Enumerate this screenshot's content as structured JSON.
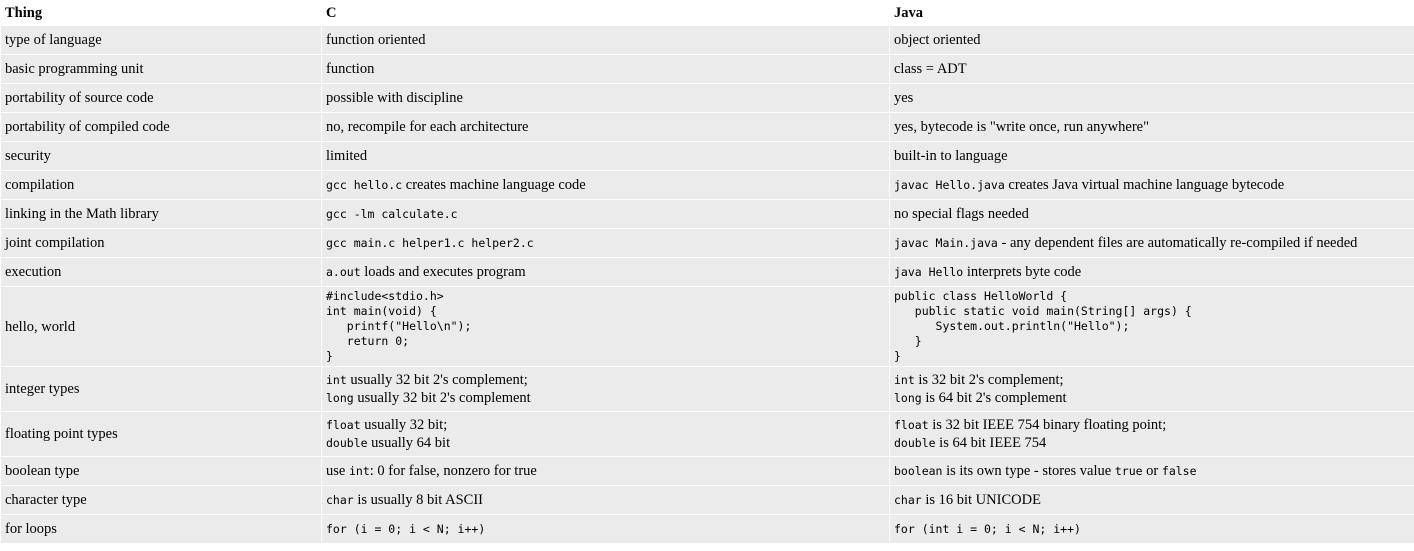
{
  "headers": [
    "Thing",
    "C",
    "Java"
  ],
  "rows": [
    {
      "thing": "type of language",
      "c": [
        {
          "t": "function oriented"
        }
      ],
      "java": [
        {
          "t": "object oriented"
        }
      ]
    },
    {
      "thing": "basic programming unit",
      "c": [
        {
          "t": "function"
        }
      ],
      "java": [
        {
          "t": "class = ADT"
        }
      ]
    },
    {
      "thing": "portability of source code",
      "c": [
        {
          "t": "possible with discipline"
        }
      ],
      "java": [
        {
          "t": "yes"
        }
      ]
    },
    {
      "thing": "portability of compiled code",
      "c": [
        {
          "t": "no, recompile for each architecture"
        }
      ],
      "java": [
        {
          "t": "yes, bytecode is \"write once, run anywhere\""
        }
      ]
    },
    {
      "thing": "security",
      "c": [
        {
          "t": "limited"
        }
      ],
      "java": [
        {
          "t": "built-in to language"
        }
      ]
    },
    {
      "thing": "compilation",
      "c": [
        {
          "code": "gcc hello.c"
        },
        {
          "t": " creates machine language code"
        }
      ],
      "java": [
        {
          "code": "javac Hello.java"
        },
        {
          "t": " creates Java virtual machine language bytecode"
        }
      ]
    },
    {
      "thing": "linking in the Math library",
      "c": [
        {
          "code": "gcc -lm calculate.c"
        }
      ],
      "java": [
        {
          "t": "no special flags needed"
        }
      ]
    },
    {
      "thing": "joint compilation",
      "c": [
        {
          "code": "gcc main.c helper1.c helper2.c"
        }
      ],
      "java": [
        {
          "code": "javac Main.java"
        },
        {
          "t": " - any dependent files are automatically re-compiled if needed"
        }
      ]
    },
    {
      "thing": "execution",
      "c": [
        {
          "code": "a.out"
        },
        {
          "t": " loads and executes program"
        }
      ],
      "java": [
        {
          "code": "java Hello"
        },
        {
          "t": " interprets byte code"
        }
      ]
    },
    {
      "thing": "hello, world",
      "kind": "pre",
      "c": [
        {
          "pre": "#include<stdio.h>\nint main(void) {\n   printf(\"Hello\\n\");\n   return 0;\n}"
        }
      ],
      "java": [
        {
          "pre": "public class HelloWorld {\n   public static void main(String[] args) {\n      System.out.println(\"Hello\");\n   }\n}"
        }
      ]
    },
    {
      "thing": "integer types",
      "kind": "two-line",
      "c": [
        {
          "code": "int"
        },
        {
          "t": " usually 32 bit 2's complement;"
        },
        {
          "br": true
        },
        {
          "code": "long"
        },
        {
          "t": " usually 32 bit 2's complement"
        }
      ],
      "java": [
        {
          "code": "int"
        },
        {
          "t": " is 32 bit 2's complement;"
        },
        {
          "br": true
        },
        {
          "code": "long"
        },
        {
          "t": " is 64 bit 2's complement"
        }
      ]
    },
    {
      "thing": "floating point types",
      "kind": "two-line",
      "c": [
        {
          "code": "float"
        },
        {
          "t": " usually 32 bit;"
        },
        {
          "br": true
        },
        {
          "code": "double"
        },
        {
          "t": " usually 64 bit"
        }
      ],
      "java": [
        {
          "code": "float"
        },
        {
          "t": " is 32 bit IEEE 754 binary floating point;"
        },
        {
          "br": true
        },
        {
          "code": "double"
        },
        {
          "t": " is 64 bit IEEE 754"
        }
      ]
    },
    {
      "thing": "boolean type",
      "c": [
        {
          "t": "use "
        },
        {
          "code": "int"
        },
        {
          "t": ": 0 for false, nonzero for true"
        }
      ],
      "java": [
        {
          "code": "boolean"
        },
        {
          "t": " is its own type - stores value "
        },
        {
          "code": "true"
        },
        {
          "t": " or "
        },
        {
          "code": "false"
        }
      ]
    },
    {
      "thing": "character type",
      "c": [
        {
          "code": "char"
        },
        {
          "t": " is usually 8 bit ASCII"
        }
      ],
      "java": [
        {
          "code": "char"
        },
        {
          "t": " is 16 bit UNICODE"
        }
      ]
    },
    {
      "thing": "for loops",
      "c": [
        {
          "code": "for (i = 0; i < N; i++)"
        }
      ],
      "java": [
        {
          "code": "for (int i = 0; i < N; i++)"
        }
      ]
    }
  ]
}
